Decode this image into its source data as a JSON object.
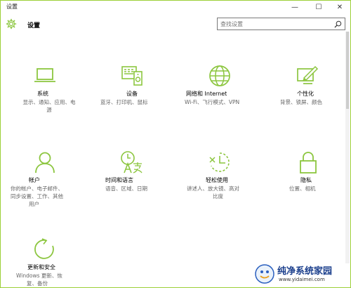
{
  "window": {
    "title": "设置"
  },
  "controls": {
    "minimize": "—",
    "maximize": "☐",
    "close": "✕"
  },
  "header": {
    "title": "设置"
  },
  "search": {
    "placeholder": "查找设置"
  },
  "tiles": [
    {
      "id": "system",
      "icon": "laptop-icon",
      "label": "系统",
      "desc": [
        "显示、通知、应用、电",
        "源"
      ]
    },
    {
      "id": "devices",
      "icon": "devices-icon",
      "label": "设备",
      "desc": [
        "蓝牙、打印机、鼠标"
      ]
    },
    {
      "id": "network",
      "icon": "globe-icon",
      "label": "网络和 Internet",
      "desc": [
        "Wi-Fi、飞行模式、VPN"
      ]
    },
    {
      "id": "personalization",
      "icon": "paint-icon",
      "label": "个性化",
      "desc": [
        "背景、锁屏、颜色"
      ]
    },
    {
      "id": "accounts",
      "icon": "person-icon",
      "label": "帐户",
      "desc": [
        "你的帐户、电子邮件、",
        "同步设置、工作、其他",
        "用户"
      ]
    },
    {
      "id": "time-language",
      "icon": "time-language-icon",
      "label": "时间和语言",
      "desc": [
        "语音、区域、日期"
      ]
    },
    {
      "id": "ease-of-access",
      "icon": "ease-of-access-icon",
      "label": "轻松使用",
      "desc": [
        "讲述人、放大镜、高对",
        "比度"
      ]
    },
    {
      "id": "privacy",
      "icon": "lock-icon",
      "label": "隐私",
      "desc": [
        "位置、相机"
      ]
    },
    {
      "id": "update-security",
      "icon": "refresh-icon",
      "label": "更新和安全",
      "desc": [
        "Windows 更新、恢",
        "复、备份"
      ]
    }
  ],
  "watermark": {
    "text": "纯净系统家园",
    "url": "www.yidaimei.com"
  },
  "colors": {
    "accent": "#8cc63f",
    "border": "#9ccf37",
    "text": "#000000",
    "desc": "#666666"
  }
}
